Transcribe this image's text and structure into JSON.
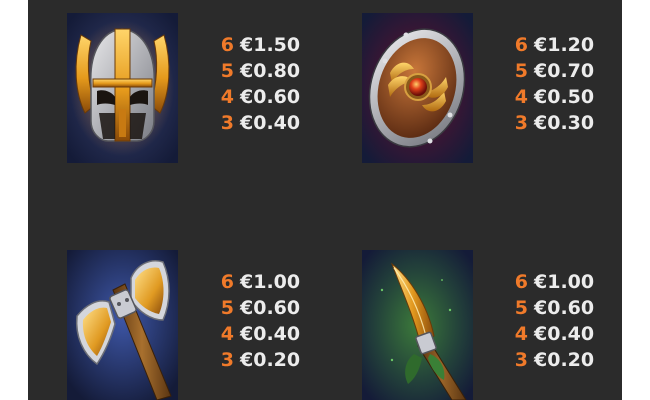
{
  "colors": {
    "panel_background": "#2b2b2b",
    "count_color": "#f07a2a",
    "value_color": "#ececec",
    "card_background": "#1c2748"
  },
  "symbols": [
    {
      "icon": "viking-helmet-icon",
      "payouts": [
        {
          "count": "6",
          "value": "€1.50"
        },
        {
          "count": "5",
          "value": "€0.80"
        },
        {
          "count": "4",
          "value": "€0.60"
        },
        {
          "count": "3",
          "value": "€0.40"
        }
      ]
    },
    {
      "icon": "round-shield-icon",
      "payouts": [
        {
          "count": "6",
          "value": "€1.20"
        },
        {
          "count": "5",
          "value": "€0.70"
        },
        {
          "count": "4",
          "value": "€0.50"
        },
        {
          "count": "3",
          "value": "€0.30"
        }
      ]
    },
    {
      "icon": "battle-axe-icon",
      "payouts": [
        {
          "count": "6",
          "value": "€1.00"
        },
        {
          "count": "5",
          "value": "€0.60"
        },
        {
          "count": "4",
          "value": "€0.40"
        },
        {
          "count": "3",
          "value": "€0.20"
        }
      ]
    },
    {
      "icon": "spear-icon",
      "payouts": [
        {
          "count": "6",
          "value": "€1.00"
        },
        {
          "count": "5",
          "value": "€0.60"
        },
        {
          "count": "4",
          "value": "€0.40"
        },
        {
          "count": "3",
          "value": "€0.20"
        }
      ]
    }
  ]
}
